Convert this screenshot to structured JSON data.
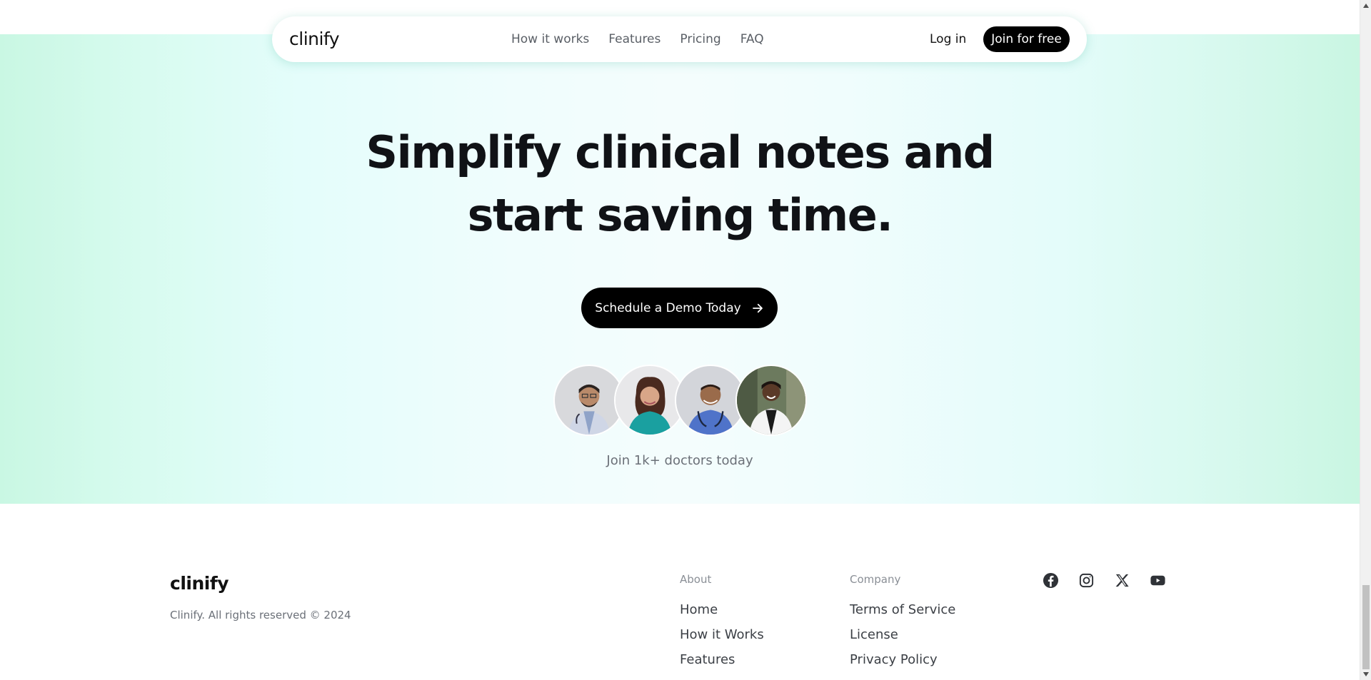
{
  "nav": {
    "logo": "clinify",
    "links": [
      "How it works",
      "Features",
      "Pricing",
      "FAQ"
    ],
    "login_label": "Log in",
    "join_label": "Join for free"
  },
  "hero": {
    "headline_line1": "Simplify clinical notes and",
    "headline_line2": "start saving time.",
    "cta_label": "Schedule a Demo Today",
    "join_text": "Join 1k+ doctors today"
  },
  "footer": {
    "logo": "clinify",
    "copyright": "Clinify. All rights reserved © 2024",
    "about": {
      "heading": "About",
      "links": [
        "Home",
        "How it Works",
        "Features"
      ]
    },
    "company": {
      "heading": "Company",
      "links": [
        "Terms of Service",
        "License",
        "Privacy Policy"
      ]
    },
    "socials": [
      "facebook-icon",
      "instagram-icon",
      "x-icon",
      "youtube-icon"
    ]
  },
  "colors": {
    "brand_dark": "#000000",
    "hero_gradient_edge": "#c9f7e3",
    "hero_gradient_center": "#f4fdfd"
  }
}
